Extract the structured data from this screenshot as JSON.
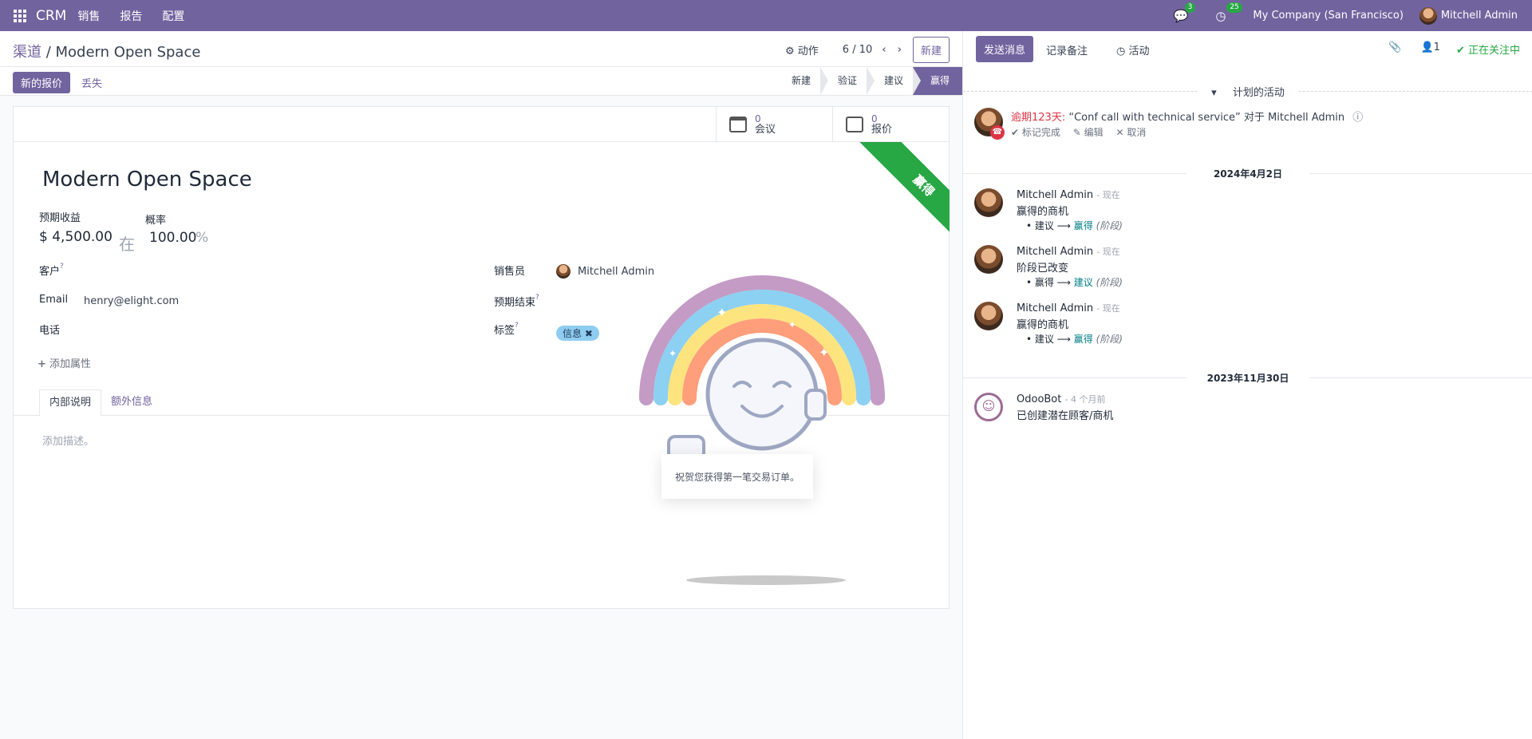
{
  "topbar": {
    "brand": "CRM",
    "menu": [
      "销售",
      "报告",
      "配置"
    ],
    "messages_count": "3",
    "activities_count": "25",
    "company": "My Company (San Francisco)",
    "user": "Mitchell Admin"
  },
  "breadcrumb": {
    "parent": "渠道",
    "separator": " / ",
    "current": "Modern Open Space"
  },
  "control_panel": {
    "actions_label": "动作",
    "pager": "6 / 10",
    "new_label": "新建"
  },
  "statusbar": {
    "new_quote_label": "新的报价",
    "lost_label": "丢失",
    "stages": [
      "新建",
      "验证",
      "建议",
      "赢得"
    ],
    "active_stage": "赢得"
  },
  "smart_buttons": [
    {
      "count": "0",
      "label": "会议",
      "icon": "calendar-icon"
    },
    {
      "count": "0",
      "label": "报价",
      "icon": "edit-icon"
    }
  ],
  "ribbon": "赢得",
  "record": {
    "name": "Modern Open Space",
    "expected_revenue_label": "预期收益",
    "expected_revenue": "$ 4,500.00",
    "at_label": "在",
    "probability_label": "概率",
    "probability": "100.00",
    "percent": "%",
    "customer_label": "客户",
    "email_label": "Email",
    "email": "henry@elight.com",
    "phone_label": "电话",
    "add_property": "添加属性",
    "salesperson_label": "销售员",
    "salesperson": "Mitchell Admin",
    "expected_closing_label": "预期结束",
    "tags_label": "标签",
    "tag": "信息"
  },
  "notebook": {
    "tabs": [
      "内部说明",
      "额外信息"
    ],
    "placeholder": "添加描述。"
  },
  "rainbow": {
    "message": "祝贺您获得第一笔交易订单。"
  },
  "chatter": {
    "send_message": "发送消息",
    "log_note": "记录备注",
    "activity": "活动",
    "followers_count": "1",
    "following": "正在关注中",
    "planned_header": "计划的活动",
    "activity_item": {
      "overdue": "逾期123天:",
      "summary": "“Conf call with technical service”",
      "for_text": "对于",
      "user": "Mitchell Admin",
      "mark_done": "标记完成",
      "edit": "编辑",
      "cancel": "取消"
    },
    "date1": "2024年4月2日",
    "date2": "2023年11月30日",
    "messages": [
      {
        "author": "Mitchell Admin",
        "when": "- 现在",
        "body": "赢得的商机",
        "old": "建议",
        "arrow": "⟶",
        "new": "赢得",
        "field": "(阶段)"
      },
      {
        "author": "Mitchell Admin",
        "when": "- 现在",
        "body": "阶段已改变",
        "old": "赢得",
        "arrow": "⟶",
        "new": "建议",
        "field": "(阶段)"
      },
      {
        "author": "Mitchell Admin",
        "when": "- 现在",
        "body": "赢得的商机",
        "old": "建议",
        "arrow": "⟶",
        "new": "赢得",
        "field": "(阶段)"
      },
      {
        "author": "OdooBot",
        "when": "- 4 个月前",
        "body": "已创建潜在顾客/商机"
      }
    ]
  },
  "colors": {
    "brand": "#71639e",
    "success": "#28a745",
    "danger": "#dc3545"
  }
}
